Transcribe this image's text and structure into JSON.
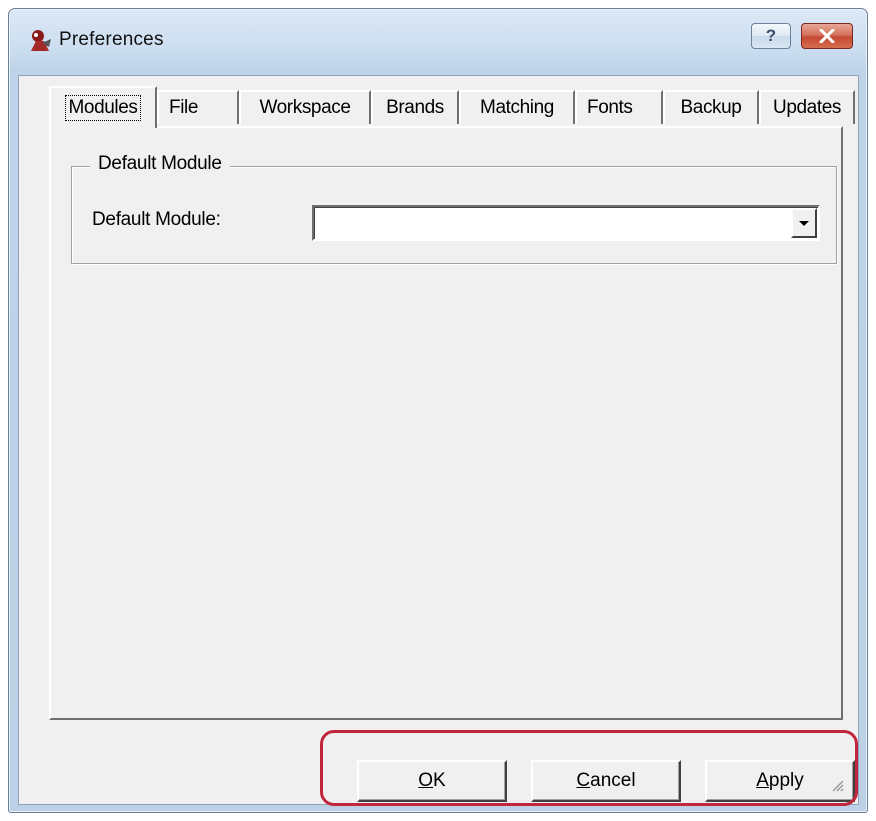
{
  "window": {
    "title": "Preferences",
    "app_icon": "app-icon",
    "help_glyph": "?",
    "close_icon": "close-icon"
  },
  "tabs": [
    {
      "label": "Modules",
      "active": true
    },
    {
      "label": "File"
    },
    {
      "label": "Workspace"
    },
    {
      "label": "Brands"
    },
    {
      "label": "Matching"
    },
    {
      "label": "Fonts"
    },
    {
      "label": "Backup"
    },
    {
      "label": "Updates"
    }
  ],
  "page": {
    "group_title": "Default Module",
    "field_label": "Default Module:",
    "combo_value": ""
  },
  "buttons": {
    "ok_access": "O",
    "ok_rest": "K",
    "cancel_access": "C",
    "cancel_rest": "ancel",
    "apply_access": "A",
    "apply_rest": "pply"
  },
  "colors": {
    "highlight_border": "#c2263d",
    "dialog_bg": "#f0f0f0"
  }
}
